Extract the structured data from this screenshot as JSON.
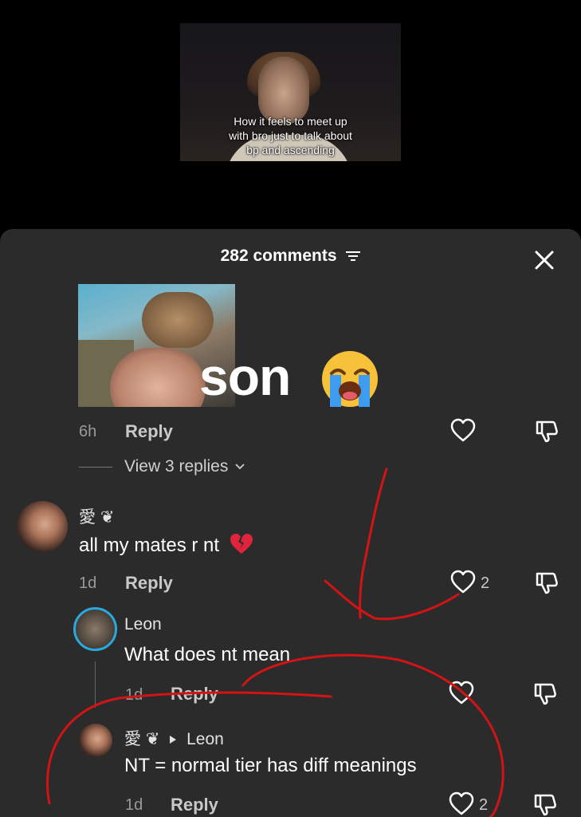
{
  "video": {
    "caption": "How it feels to meet up\nwith bro just to talk about\nbp and ascending"
  },
  "sheet": {
    "title": "282 comments",
    "close_icon": "close-icon",
    "filter_icon": "filter-icon"
  },
  "top_comment": {
    "sticker_text": "son",
    "emoji": "loudly-crying-face-emoji",
    "time": "6h",
    "reply_label": "Reply",
    "view_replies": "View 3 replies"
  },
  "comments": [
    {
      "username": "愛 ❦",
      "text": "all my mates r nt",
      "emoji": "broken-heart-emoji",
      "time": "1d",
      "reply_label": "Reply",
      "likes": "2"
    },
    {
      "username": "Leon",
      "text": "What does nt mean",
      "time": "1d",
      "reply_label": "Reply"
    },
    {
      "username": "愛 ❦",
      "reply_to": "Leon",
      "text": "NT = normal tier has diff meanings",
      "time": "1d",
      "reply_label": "Reply",
      "likes": "2"
    }
  ],
  "colors": {
    "sheet_bg": "#2b2b2c",
    "annotation_red": "#d21414",
    "avatar_ring": "#2aa9e0"
  }
}
